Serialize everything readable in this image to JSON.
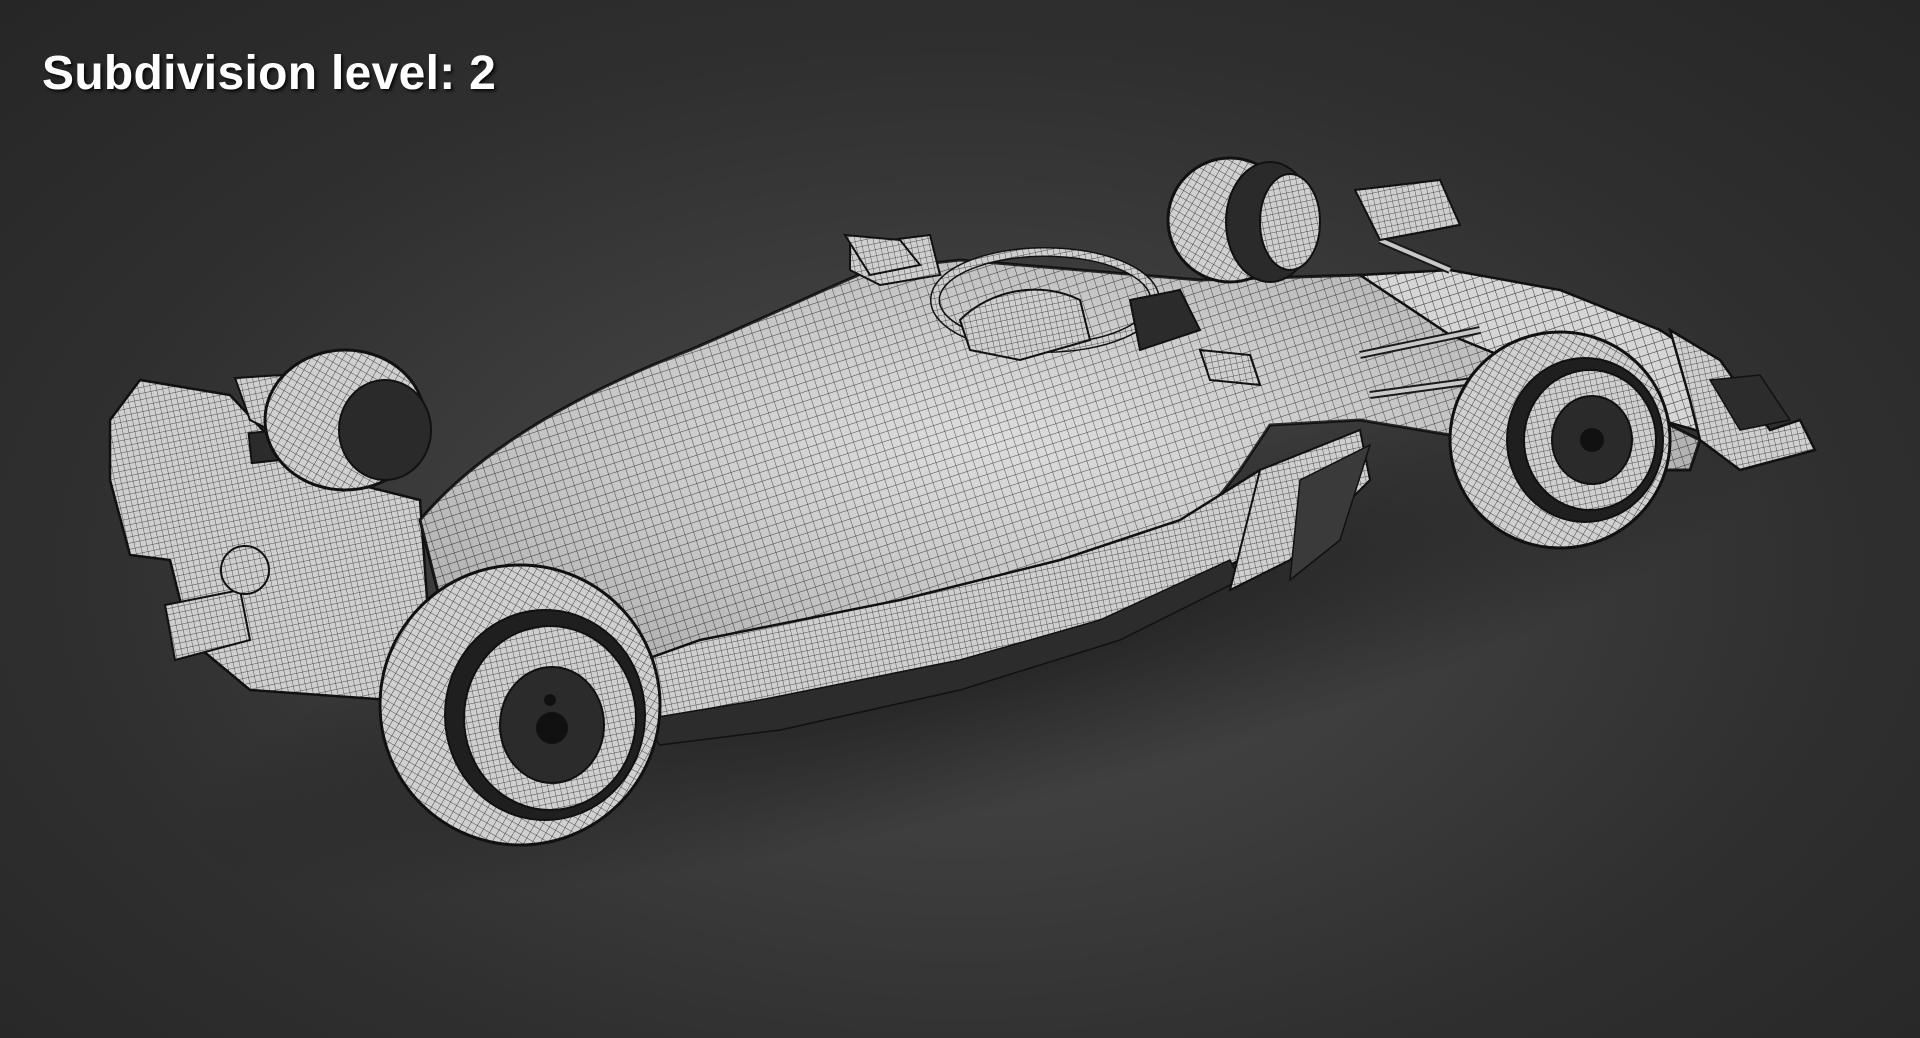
{
  "overlay": {
    "subdivision_label": "Subdivision level: 2"
  },
  "scene": {
    "subject": "formula-one-car-wireframe",
    "background_color": "#3a3a3a",
    "mesh_fill_color": "#d9d9d9",
    "wire_color": "#1a1a1a"
  }
}
